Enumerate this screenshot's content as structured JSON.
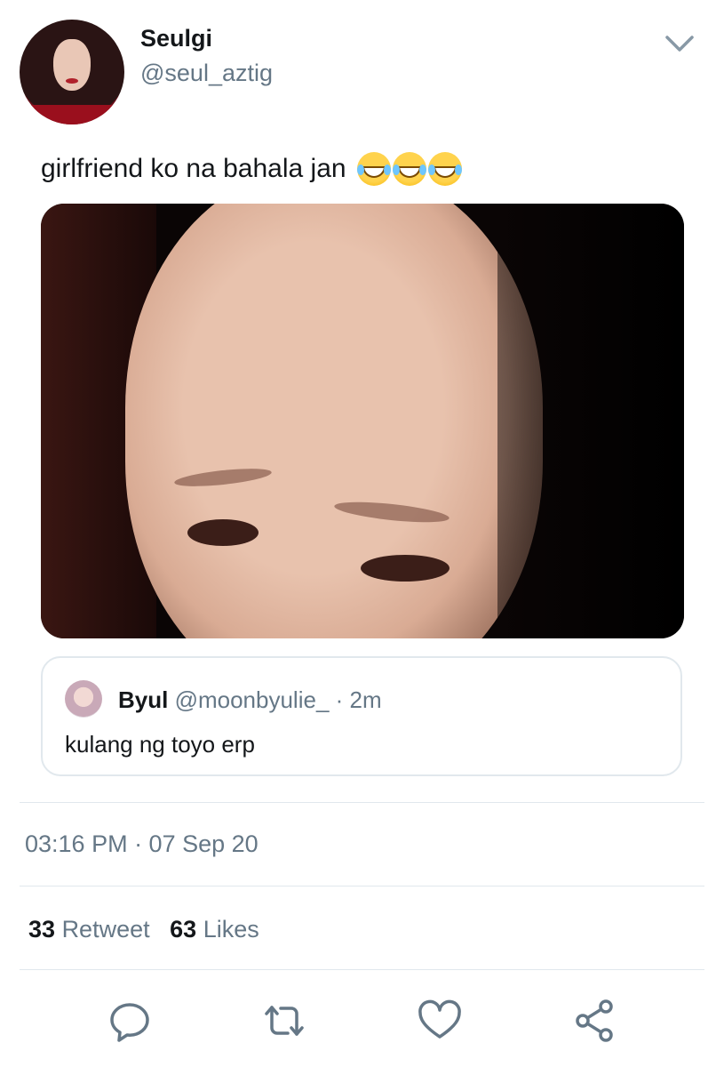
{
  "tweet": {
    "author_name": "Seulgi",
    "author_handle": "@seul_aztig",
    "text": "girlfriend ko na bahala jan",
    "emojis": [
      "laughing-tears",
      "laughing-tears",
      "laughing-tears"
    ]
  },
  "quoted": {
    "author_name": "Byul",
    "author_handle": "@moonbyulie_",
    "separator": "·",
    "time": "2m",
    "text": "kulang ng toyo erp"
  },
  "meta": {
    "timestamp": "03:16 PM · 07 Sep 20"
  },
  "stats": {
    "retweet_count": "33",
    "retweet_label": "Retweet",
    "likes_count": "63",
    "likes_label": "Likes"
  },
  "actions": {
    "icons": [
      "reply-icon",
      "retweet-icon",
      "like-icon",
      "share-icon"
    ]
  },
  "colors": {
    "text_primary": "#14171a",
    "text_secondary": "#657786",
    "border": "#e1e8ed",
    "icon": "#657786"
  }
}
